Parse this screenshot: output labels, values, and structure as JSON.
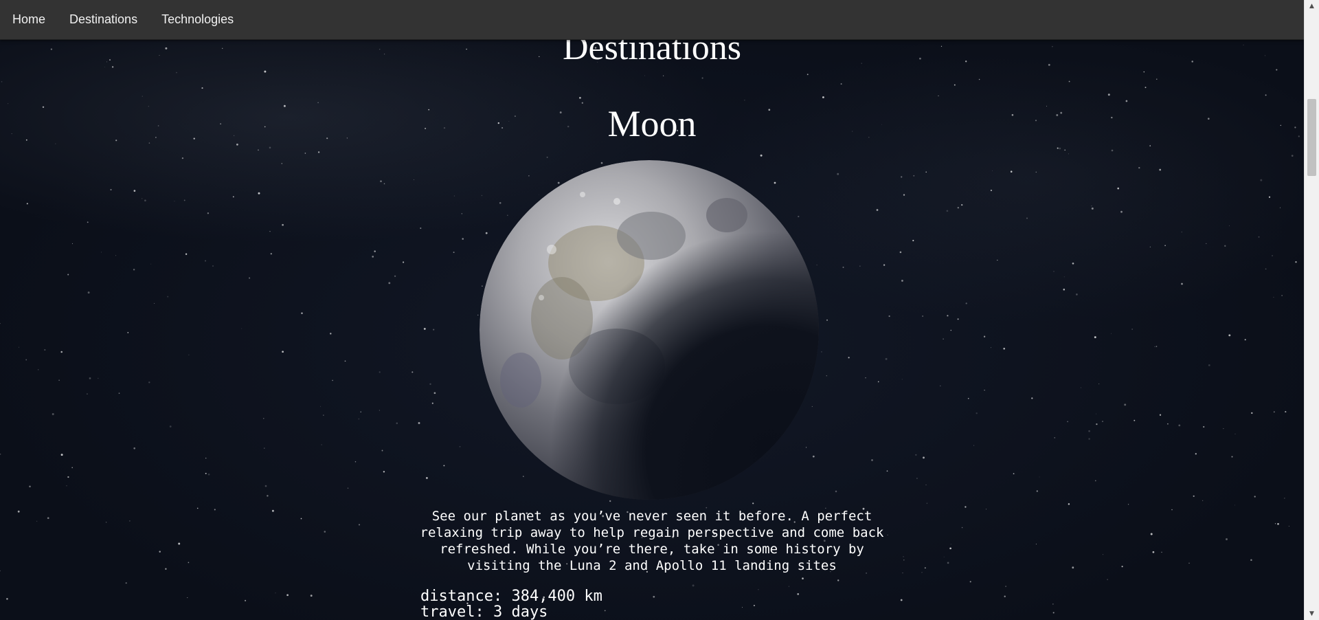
{
  "nav": {
    "items": [
      {
        "label": "Home"
      },
      {
        "label": "Destinations"
      },
      {
        "label": "Technologies"
      }
    ]
  },
  "page": {
    "heading": "Destinations"
  },
  "destination": {
    "name": "Moon",
    "description": "See our planet as you’ve never seen it before. A perfect relaxing trip away to help regain perspective and come back refreshed. While you’re there, take in some history by visiting the Luna 2 and Apollo 11 landing sites",
    "distance": "distance: 384,400 km",
    "travel": "travel: 3 days"
  },
  "colors": {
    "navbar": "#333333",
    "background": "#0b0f19",
    "text": "#ffffff"
  }
}
